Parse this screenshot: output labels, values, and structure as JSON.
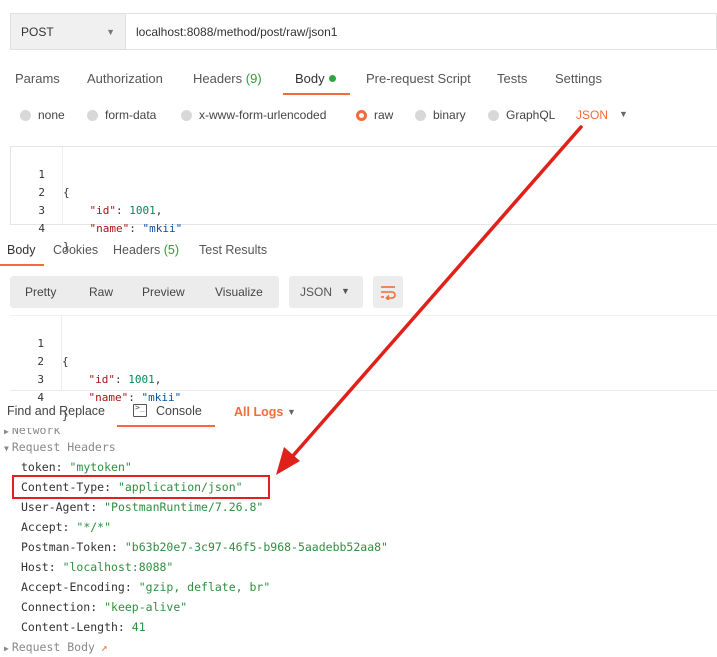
{
  "request": {
    "method": "POST",
    "url": "localhost:8088/method/post/raw/json1"
  },
  "request_tabs": [
    {
      "label": "Params"
    },
    {
      "label": "Authorization"
    },
    {
      "label": "Headers",
      "count": "(9)"
    },
    {
      "label": "Body"
    },
    {
      "label": "Pre-request Script"
    },
    {
      "label": "Tests"
    },
    {
      "label": "Settings"
    }
  ],
  "body_types": {
    "options": [
      "none",
      "form-data",
      "x-www-form-urlencoded",
      "raw",
      "binary",
      "GraphQL"
    ],
    "selected": "raw",
    "format": "JSON"
  },
  "request_body": {
    "line_numbers": [
      "1",
      "2",
      "3",
      "4"
    ],
    "open_brace": "{",
    "close_brace": "}",
    "id_key": "\"id\"",
    "id_val": "1001",
    "name_key": "\"name\"",
    "name_val": "\"mkii\""
  },
  "response_tabs": [
    {
      "label": "Body"
    },
    {
      "label": "Cookies"
    },
    {
      "label": "Headers",
      "count": "(5)"
    },
    {
      "label": "Test Results"
    }
  ],
  "view_modes": [
    "Pretty",
    "Raw",
    "Preview",
    "Visualize"
  ],
  "response_format": "JSON",
  "console_tabs": {
    "find_replace": "Find and Replace",
    "console": "Console",
    "all_logs": "All Logs"
  },
  "console": {
    "network_label": "Network",
    "request_headers_label": "Request Headers",
    "request_body_label": "Request Body",
    "headers": [
      {
        "key": "token:",
        "value": "\"mytoken\""
      },
      {
        "key": "Content-Type:",
        "value": "\"application/json\""
      },
      {
        "key": "User-Agent:",
        "value": "\"PostmanRuntime/7.26.8\""
      },
      {
        "key": "Accept:",
        "value": "\"*/*\""
      },
      {
        "key": "Postman-Token:",
        "value": "\"b63b20e7-3c97-46f5-b968-5aadebb52aa8\""
      },
      {
        "key": "Host:",
        "value": "\"localhost:8088\""
      },
      {
        "key": "Accept-Encoding:",
        "value": "\"gzip, deflate, br\""
      },
      {
        "key": "Connection:",
        "value": "\"keep-alive\""
      },
      {
        "key": "Content-Length:",
        "value": "41"
      }
    ]
  },
  "colors": {
    "accent": "#f26b3a",
    "annotation": "#e0211a",
    "success": "#2fa53f"
  }
}
